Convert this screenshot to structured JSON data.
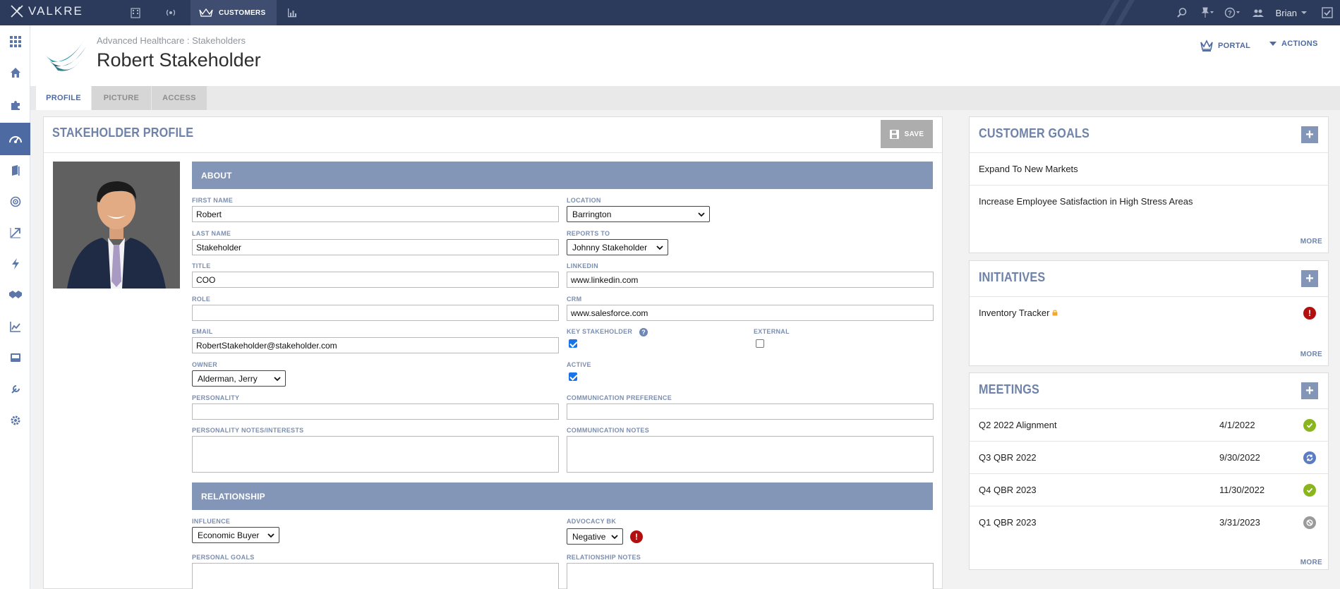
{
  "app": {
    "name": "VALKRE"
  },
  "topnav": {
    "active_label": "CUSTOMERS",
    "user_name": "Brian"
  },
  "header": {
    "breadcrumb": "Advanced Healthcare : Stakeholders",
    "title": "Robert Stakeholder",
    "portal_label": "PORTAL",
    "actions_label": "ACTIONS"
  },
  "tabs": [
    {
      "label": "PROFILE"
    },
    {
      "label": "PICTURE"
    },
    {
      "label": "ACCESS"
    }
  ],
  "profile": {
    "title": "STAKEHOLDER PROFILE",
    "save_label": "SAVE",
    "about_label": "ABOUT",
    "relationship_label": "RELATIONSHIP",
    "fields": {
      "first_name": {
        "label": "FIRST NAME",
        "value": "Robert"
      },
      "last_name": {
        "label": "LAST NAME",
        "value": "Stakeholder"
      },
      "title": {
        "label": "TITLE",
        "value": "COO"
      },
      "role": {
        "label": "ROLE",
        "value": ""
      },
      "email": {
        "label": "EMAIL",
        "value": "RobertStakeholder@stakeholder.com"
      },
      "owner": {
        "label": "OWNER",
        "value": "Alderman, Jerry"
      },
      "personality": {
        "label": "PERSONALITY",
        "value": ""
      },
      "personality_notes": {
        "label": "PERSONALITY NOTES/INTERESTS",
        "value": ""
      },
      "location": {
        "label": "LOCATION",
        "value": "Barrington"
      },
      "reports_to": {
        "label": "REPORTS TO",
        "value": "Johnny Stakeholder"
      },
      "linkedin": {
        "label": "LINKEDIN",
        "value": "www.linkedin.com"
      },
      "crm": {
        "label": "CRM",
        "value": "www.salesforce.com"
      },
      "key_stakeholder": {
        "label": "KEY STAKEHOLDER",
        "checked": true
      },
      "external": {
        "label": "EXTERNAL",
        "checked": false
      },
      "active": {
        "label": "ACTIVE",
        "checked": true
      },
      "communication_preference": {
        "label": "COMMUNICATION PREFERENCE",
        "value": ""
      },
      "communication_notes": {
        "label": "COMMUNICATION NOTES",
        "value": ""
      },
      "influence": {
        "label": "INFLUENCE",
        "value": "Economic Buyer"
      },
      "advocacy": {
        "label": "ADVOCACY BK",
        "value": "Negative"
      },
      "personal_goals": {
        "label": "PERSONAL GOALS",
        "value": ""
      },
      "relationship_notes": {
        "label": "RELATIONSHIP NOTES",
        "value": ""
      }
    }
  },
  "customer_goals": {
    "title": "CUSTOMER GOALS",
    "items": [
      "Expand To New Markets",
      "Increase Employee Satisfaction in High Stress Areas"
    ],
    "more_label": "MORE"
  },
  "initiatives": {
    "title": "INITIATIVES",
    "items": [
      {
        "name": "Inventory Tracker",
        "status": "alert"
      }
    ],
    "more_label": "MORE"
  },
  "meetings": {
    "title": "MEETINGS",
    "items": [
      {
        "name": "Q2 2022 Alignment",
        "date": "4/1/2022",
        "status": "complete"
      },
      {
        "name": "Q3 QBR 2022",
        "date": "9/30/2022",
        "status": "in-progress"
      },
      {
        "name": "Q4 QBR 2023",
        "date": "11/30/2022",
        "status": "complete"
      },
      {
        "name": "Q1 QBR 2023",
        "date": "3/31/2023",
        "status": "cancelled"
      }
    ],
    "more_label": "MORE"
  },
  "colors": {
    "topbar": "#2c3a5c",
    "accent": "#4e6aa2",
    "section_band": "#8396b7",
    "complete": "#8ab51c",
    "in_progress": "#5b7bc2",
    "cancelled": "#9a9a9a",
    "alert": "#b30f0f"
  }
}
